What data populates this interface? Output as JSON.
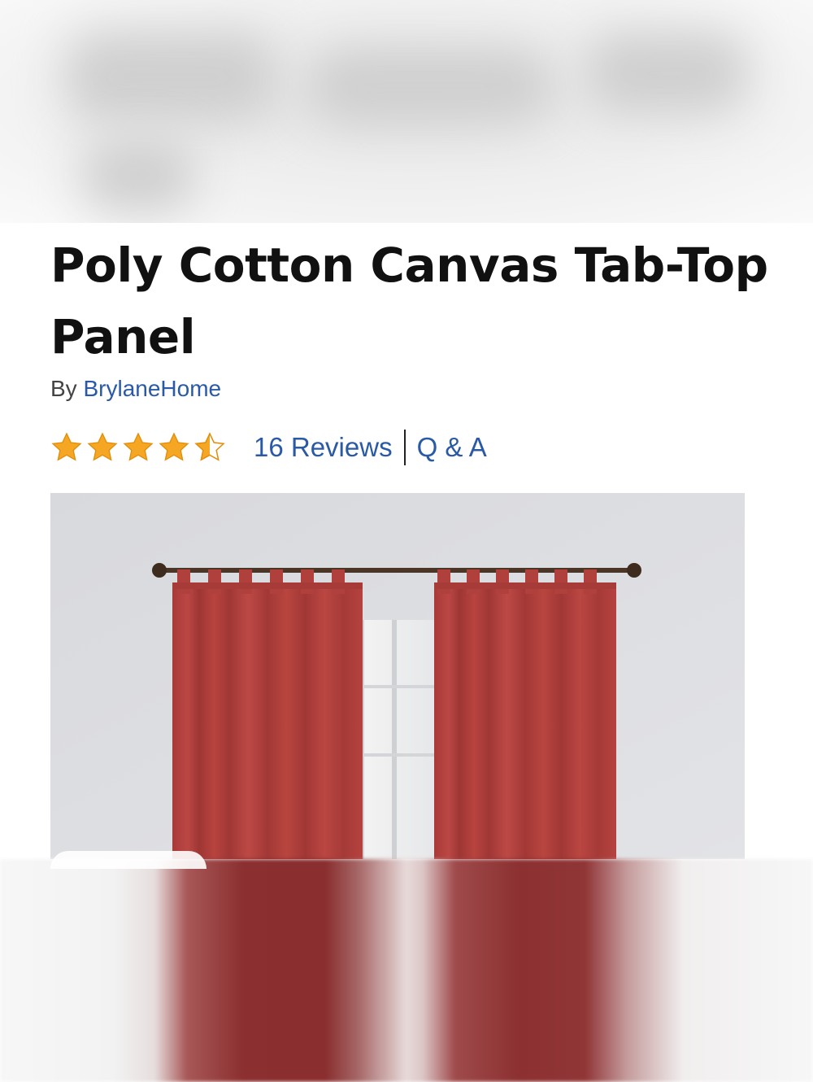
{
  "product": {
    "title": "Poly Cotton Canvas Tab-Top Panel",
    "by_prefix": "By",
    "brand": "BrylaneHome",
    "rating": 4.5,
    "rating_max": 5,
    "reviews_label": "16 Reviews",
    "qa_label": "Q & A",
    "image_alt": "red tab-top curtain panels on rod"
  },
  "colors": {
    "star": "#F5A623",
    "link": "#2A5AA6",
    "curtain": "#B2403D"
  },
  "icons": {
    "star_full": "star-icon",
    "star_half": "star-half-icon"
  }
}
